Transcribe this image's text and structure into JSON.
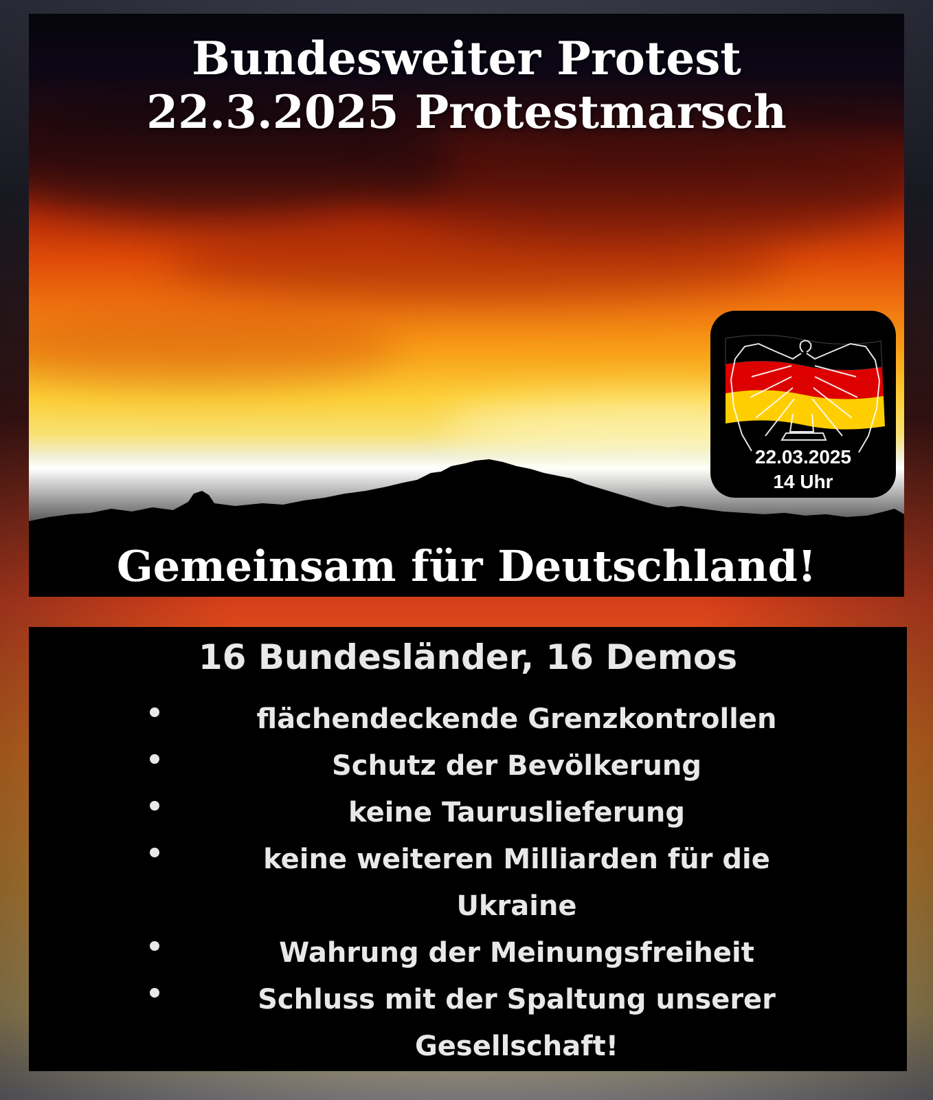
{
  "poster": {
    "title_line1": "Bundesweiter Protest",
    "title_line2": "22.3.2025 Protestmarsch",
    "slogan": "Gemeinsam für Deutschland!",
    "badge": {
      "date": "22.03.2025",
      "time": "14 Uhr",
      "flag_colors": [
        "#000000",
        "#dd0000",
        "#ffce00"
      ]
    }
  },
  "info": {
    "heading": "16 Bundesländer, 16 Demos",
    "demands": [
      "flächendeckende Grenzkontrollen",
      "Schutz der Bevölkerung",
      "keine Tauruslieferung",
      "keine weiteren Milliarden für die Ukraine",
      "Wahrung der Meinungsfreiheit",
      "Schluss mit der Spaltung unserer Gesellschaft!"
    ]
  }
}
